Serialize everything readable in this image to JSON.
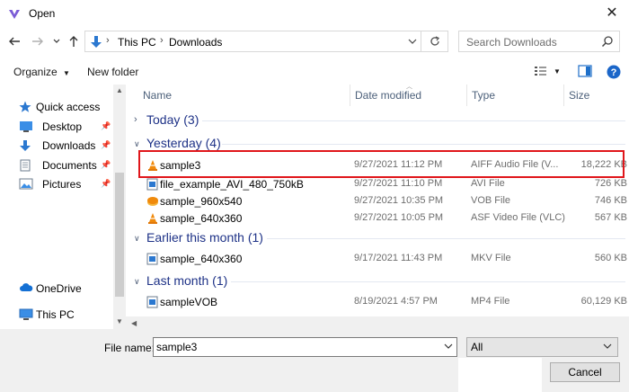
{
  "window": {
    "title": "Open"
  },
  "address": {
    "crumbs": [
      "This PC",
      "Downloads"
    ]
  },
  "search": {
    "placeholder": "Search Downloads"
  },
  "toolbar": {
    "organize": "Organize",
    "new_folder": "New folder"
  },
  "nav": {
    "items": [
      {
        "label": "Quick access",
        "icon": "star-icon"
      },
      {
        "label": "Desktop",
        "icon": "desktop-icon",
        "pinned": true
      },
      {
        "label": "Downloads",
        "icon": "download-icon",
        "pinned": true
      },
      {
        "label": "Documents",
        "icon": "documents-icon",
        "pinned": true
      },
      {
        "label": "Pictures",
        "icon": "pictures-icon",
        "pinned": true
      },
      {
        "label": "OneDrive",
        "icon": "cloud-icon"
      },
      {
        "label": "This PC",
        "icon": "pc-icon"
      }
    ]
  },
  "columns": {
    "name": "Name",
    "date": "Date modified",
    "type": "Type",
    "size": "Size"
  },
  "groups": [
    {
      "label": "Today (3)",
      "collapsed": true
    },
    {
      "label": "Yesterday (4)",
      "collapsed": false
    },
    {
      "label": "Earlier this month (1)",
      "collapsed": false
    },
    {
      "label": "Last month (1)",
      "collapsed": false
    }
  ],
  "files": [
    {
      "name": "sample3",
      "date": "9/27/2021 11:12 PM",
      "type": "AIFF Audio File (V...",
      "size": "18,222 KB",
      "icon": "vlc-cone-icon"
    },
    {
      "name": "file_example_AVI_480_750kB",
      "date": "9/27/2021 11:10 PM",
      "type": "AVI File",
      "size": "726 KB",
      "icon": "video-file-icon"
    },
    {
      "name": "sample_960x540",
      "date": "9/27/2021 10:35 PM",
      "type": "VOB File",
      "size": "746 KB",
      "icon": "vob-file-icon"
    },
    {
      "name": "sample_640x360",
      "date": "9/27/2021 10:05 PM",
      "type": "ASF Video File (VLC)",
      "size": "567 KB",
      "icon": "vlc-cone-icon"
    },
    {
      "name": "sample_640x360",
      "date": "9/17/2021 11:43 PM",
      "type": "MKV File",
      "size": "560 KB",
      "icon": "video-file-icon"
    },
    {
      "name": "sampleVOB",
      "date": "8/19/2021 4:57 PM",
      "type": "MP4 File",
      "size": "60,129 KB",
      "icon": "video-file-icon"
    }
  ],
  "bottom": {
    "file_name_label": "File name:",
    "file_name_value": "sample3",
    "file_type_value": "All",
    "cancel_label": "Cancel"
  },
  "colors": {
    "highlight": "#e0161b",
    "group_text": "#1e3287",
    "accent_blue": "#0078d7"
  }
}
